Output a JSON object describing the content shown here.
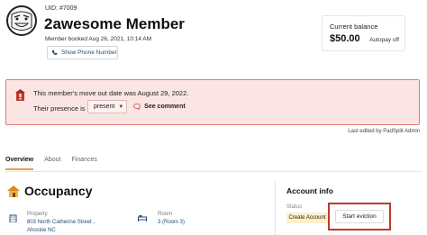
{
  "member": {
    "uid": "UID: #7009",
    "name": "2awesome Member",
    "booked": "Member booked Aug 26, 2021, 10:14 AM",
    "show_phone_label": "Show Phone Number"
  },
  "balance": {
    "label": "Current balance",
    "amount": "$50.00",
    "autopay": "Autopay off"
  },
  "alert": {
    "message": "This member's move out date was August 29, 2022.",
    "presence_label": "Their presence is",
    "presence_value": "present",
    "see_comment_label": "See comment"
  },
  "last_edited": "Last edited by PadSplit Admin",
  "tabs": [
    {
      "label": "Overview",
      "active": true
    },
    {
      "label": "About",
      "active": false
    },
    {
      "label": "Finances",
      "active": false
    }
  ],
  "occupancy": {
    "title": "Occupancy",
    "property_label": "Property",
    "property_line1": "803 North Catherine Street ,",
    "property_line2": "Ahoskie NC",
    "room_label": "Room",
    "room_value": "3 (Room 3)"
  },
  "account": {
    "title": "Account info",
    "status_label": "Status",
    "status_value": "Create Account",
    "eviction_label": "Start eviction"
  },
  "colors": {
    "alert_bg": "#fbe4e4",
    "alert_border": "#e07b7b",
    "tab_accent": "#e0a24a",
    "highlight_box": "#c0392b",
    "status_badge": "#fdf0c8"
  },
  "icons": [
    "avatar-meme-face",
    "phone-icon",
    "warning-house-icon",
    "comment-icon",
    "house-icon",
    "building-icon",
    "bed-icon",
    "chevron-down-icon"
  ]
}
